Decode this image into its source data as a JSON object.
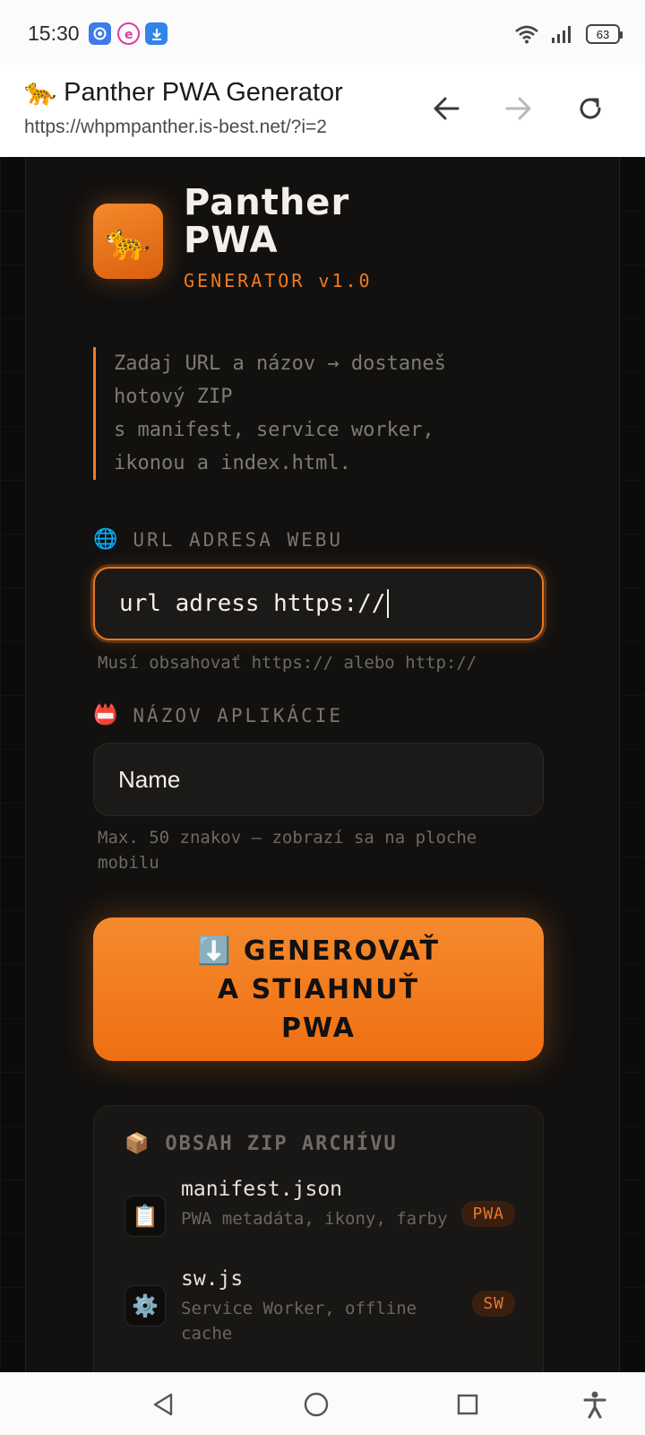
{
  "status_bar": {
    "time": "15:30",
    "battery": "63",
    "notification_icons": [
      "browser-icon",
      "e-app-icon",
      "download-icon"
    ],
    "system_icons": [
      "wifi-icon",
      "signal-icon",
      "battery-icon"
    ]
  },
  "browser": {
    "title": "🐆 Panther PWA Generator",
    "url": "https://whpmpanther.is-best.net/?i=2",
    "buttons": [
      "back-arrow-icon",
      "forward-arrow-icon",
      "reload-icon"
    ]
  },
  "brand": {
    "logo_emoji": "🐆",
    "title_line1": "Panther",
    "title_line2": "PWA",
    "subtitle": "GENERATOR v1.0",
    "accent_color": "#f07a22"
  },
  "description": {
    "line1": "Zadaj URL a názov → dostaneš",
    "line2": "hotový ZIP",
    "line3": "s manifest, service worker,",
    "line4": "ikonou a index.html."
  },
  "url_field": {
    "icon": "🌐",
    "label": "URL ADRESA WEBU",
    "value": "url adress https://",
    "hint": "Musí obsahovať https:// alebo http://"
  },
  "name_field": {
    "icon": "📛",
    "label": "NÁZOV APLIKÁCIE",
    "value": "Name",
    "hint_line1": "Max. 50 znakov — zobrazí sa na ploche",
    "hint_line2": "mobilu"
  },
  "generate_button": {
    "line1": "⬇️ GENEROVAŤ",
    "line2": "A STIAHNUŤ",
    "line3": "PWA"
  },
  "zip": {
    "icon": "📦",
    "title": "OBSAH ZIP ARCHÍVU",
    "items": [
      {
        "icon": "📋",
        "name": "manifest.json",
        "desc": "PWA metadáta, ikony, farby",
        "badge": "PWA"
      },
      {
        "icon": "⚙️",
        "name": "sw.js",
        "desc": "Service Worker, offline cache",
        "badge": "SW"
      }
    ]
  },
  "nav": [
    "back-triangle-icon",
    "home-circle-icon",
    "recents-square-icon",
    "accessibility-icon"
  ]
}
